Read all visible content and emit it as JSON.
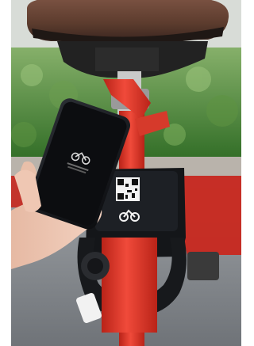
{
  "photo": {
    "phone_screen": {
      "icon": "bicycle-icon",
      "line1": "",
      "line2": ""
    },
    "lock_panel": {
      "qr": "qr-code",
      "icon": "bicycle-icon"
    },
    "colors": {
      "background": "#ffffff",
      "bike_red": "#e8352a",
      "panel_dark": "#1a1c20",
      "saddle_brown": "#5a3a2c",
      "foliage": "#3f7d2d",
      "ground": "#8a8f94"
    }
  }
}
